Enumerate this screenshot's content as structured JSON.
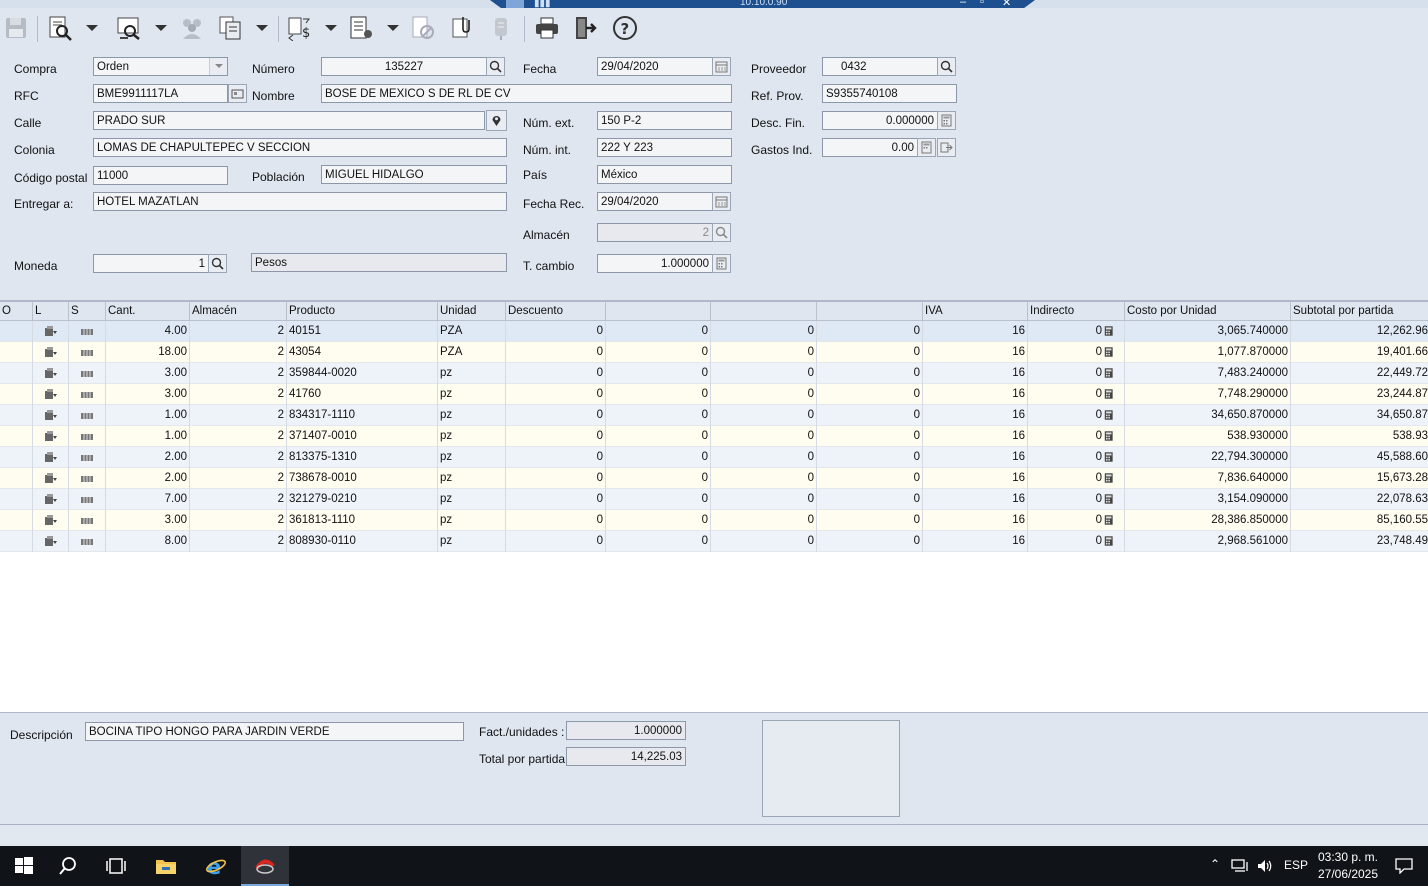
{
  "remote_bar": {
    "address": "10.10.0.90"
  },
  "toolbar": {
    "buttons": [
      "save-icon",
      "search-doc-icon",
      "preview-icon",
      "users-icon",
      "docs-icon",
      "currency-icon",
      "report-icon",
      "cancel-doc-icon",
      "attach-icon",
      "tag-icon",
      "print-icon",
      "exit-icon",
      "help-icon"
    ]
  },
  "form": {
    "compra_label": "Compra",
    "compra_value": "Orden",
    "numero_label": "Número",
    "numero_value": "135227",
    "fecha_label": "Fecha",
    "fecha_value": "29/04/2020",
    "proveedor_label": "Proveedor",
    "proveedor_value": "0432",
    "rfc_label": "RFC",
    "rfc_value": "BME9911117LA",
    "nombre_label": "Nombre",
    "nombre_value": "BOSE DE MEXICO S DE RL DE CV",
    "refprov_label": "Ref. Prov.",
    "refprov_value": "S9355740108",
    "calle_label": "Calle",
    "calle_value": "PRADO SUR",
    "numext_label": "Núm. ext.",
    "numext_value": "150 P-2",
    "descfin_label": "Desc. Fin.",
    "descfin_value": "0.000000",
    "colonia_label": "Colonia",
    "colonia_value": "LOMAS DE CHAPULTEPEC V SECCION",
    "numint_label": "Núm. int.",
    "numint_value": "222 Y 223",
    "gastos_label": "Gastos Ind.",
    "gastos_value": "0.00",
    "cp_label": "Código postal",
    "cp_value": "11000",
    "poblacion_label": "Población",
    "poblacion_value": "MIGUEL HIDALGO",
    "pais_label": "País",
    "pais_value": "México",
    "entregar_label": "Entregar a:",
    "entregar_value": "HOTEL MAZATLAN",
    "fecharec_label": "Fecha Rec.",
    "fecharec_value": "29/04/2020",
    "almacen_label": "Almacén",
    "almacen_value": "2",
    "moneda_label": "Moneda",
    "moneda_value": "1",
    "moneda_name": "Pesos",
    "tcambio_label": "T. cambio",
    "tcambio_value": "1.000000"
  },
  "grid": {
    "headers": [
      "O",
      "L",
      "S",
      "Cant.",
      "Almacén",
      "Producto",
      "Unidad",
      "Descuento",
      "",
      "",
      "",
      "IVA",
      "Indirecto",
      "Costo por Unidad",
      "Subtotal por partida"
    ],
    "rows": [
      {
        "cant": "4.00",
        "alm": "2",
        "prod": "40151",
        "unidad": "PZA",
        "d1": "0",
        "d2": "0",
        "d3": "0",
        "d4": "0",
        "iva": "16",
        "ind": "0",
        "costo": "3,065.740000",
        "sub": "12,262.96"
      },
      {
        "cant": "18.00",
        "alm": "2",
        "prod": "43054",
        "unidad": "PZA",
        "d1": "0",
        "d2": "0",
        "d3": "0",
        "d4": "0",
        "iva": "16",
        "ind": "0",
        "costo": "1,077.870000",
        "sub": "19,401.66"
      },
      {
        "cant": "3.00",
        "alm": "2",
        "prod": "359844-0020",
        "unidad": "pz",
        "d1": "0",
        "d2": "0",
        "d3": "0",
        "d4": "0",
        "iva": "16",
        "ind": "0",
        "costo": "7,483.240000",
        "sub": "22,449.72"
      },
      {
        "cant": "3.00",
        "alm": "2",
        "prod": "41760",
        "unidad": "pz",
        "d1": "0",
        "d2": "0",
        "d3": "0",
        "d4": "0",
        "iva": "16",
        "ind": "0",
        "costo": "7,748.290000",
        "sub": "23,244.87"
      },
      {
        "cant": "1.00",
        "alm": "2",
        "prod": "834317-1110",
        "unidad": "pz",
        "d1": "0",
        "d2": "0",
        "d3": "0",
        "d4": "0",
        "iva": "16",
        "ind": "0",
        "costo": "34,650.870000",
        "sub": "34,650.87"
      },
      {
        "cant": "1.00",
        "alm": "2",
        "prod": "371407-0010",
        "unidad": "pz",
        "d1": "0",
        "d2": "0",
        "d3": "0",
        "d4": "0",
        "iva": "16",
        "ind": "0",
        "costo": "538.930000",
        "sub": "538.93"
      },
      {
        "cant": "2.00",
        "alm": "2",
        "prod": "813375-1310",
        "unidad": "pz",
        "d1": "0",
        "d2": "0",
        "d3": "0",
        "d4": "0",
        "iva": "16",
        "ind": "0",
        "costo": "22,794.300000",
        "sub": "45,588.60"
      },
      {
        "cant": "2.00",
        "alm": "2",
        "prod": "738678-0010",
        "unidad": "pz",
        "d1": "0",
        "d2": "0",
        "d3": "0",
        "d4": "0",
        "iva": "16",
        "ind": "0",
        "costo": "7,836.640000",
        "sub": "15,673.28"
      },
      {
        "cant": "7.00",
        "alm": "2",
        "prod": "321279-0210",
        "unidad": "pz",
        "d1": "0",
        "d2": "0",
        "d3": "0",
        "d4": "0",
        "iva": "16",
        "ind": "0",
        "costo": "3,154.090000",
        "sub": "22,078.63"
      },
      {
        "cant": "3.00",
        "alm": "2",
        "prod": "361813-1110",
        "unidad": "pz",
        "d1": "0",
        "d2": "0",
        "d3": "0",
        "d4": "0",
        "iva": "16",
        "ind": "0",
        "costo": "28,386.850000",
        "sub": "85,160.55"
      },
      {
        "cant": "8.00",
        "alm": "2",
        "prod": "808930-0110",
        "unidad": "pz",
        "d1": "0",
        "d2": "0",
        "d3": "0",
        "d4": "0",
        "iva": "16",
        "ind": "0",
        "costo": "2,968.561000",
        "sub": "23,748.49"
      }
    ]
  },
  "bottom": {
    "descripcion_label": "Descripción",
    "descripcion_value": "BOCINA TIPO HONGO PARA JARDIN VERDE",
    "fact_label": "Fact./unidades :",
    "fact_value": "1.000000",
    "total_label": "Total por partida",
    "total_value": "14,225.03"
  },
  "taskbar": {
    "lang": "ESP",
    "time": "03:30 p. m.",
    "date": "27/06/2025"
  }
}
